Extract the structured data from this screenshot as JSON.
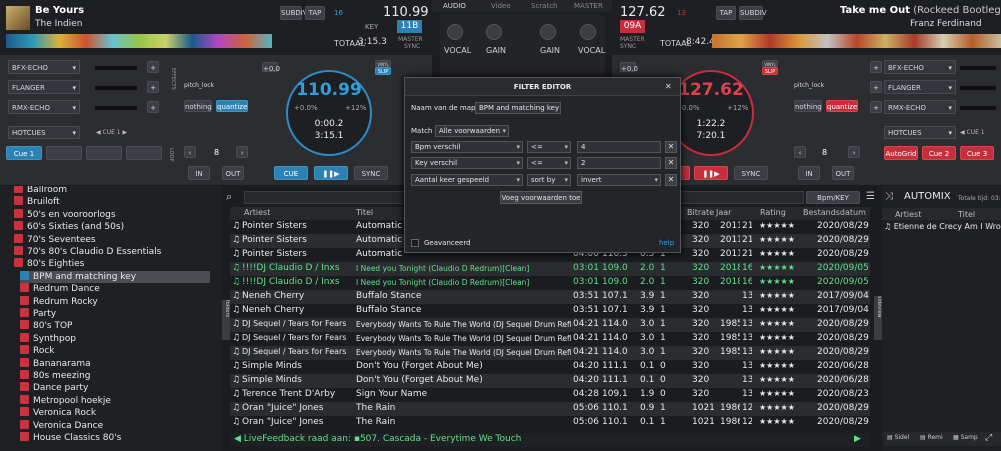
{
  "deck_left": {
    "title": "Be Yours",
    "artist": "The Indien",
    "bpm_main": "110.99",
    "bpm_small": "110.99",
    "key": "11B",
    "key_label": "KEY",
    "number": "16",
    "total_label": "TOTAAL",
    "total_time": "3:15.3",
    "master_label": "MASTER",
    "sync_label": "SYNC",
    "pitch": "+0.0",
    "bpm_ring": "110.99",
    "pct_minus": "+0.0%",
    "pct_plus": "+12%",
    "elapsed": "0:00.2",
    "remain": "3:15.1",
    "mode": "SLIP",
    "hotcues": "HOTCUES",
    "cue1": "CUE 1",
    "cue_pad": "Cue 1",
    "loop": "8",
    "in": "IN",
    "out": "OUT",
    "cue": "CUE",
    "play": "❚❚▶",
    "sync": "SYNC",
    "fx1": "BFX-ECHO",
    "fx2": "FLANGER",
    "fx3": "RMX-ECHO",
    "pitchlock": "pitch_lock",
    "nothing": "nothing",
    "quantize": "quantize_setti...",
    "vertical_fx": "EFFECTS",
    "vertical_loop": "LOOP",
    "sub_btns": [
      "SUBDIV",
      "TAP"
    ],
    "vinyl": "VINYL"
  },
  "deck_right": {
    "title": "Take me Out",
    "title_suffix": "(Rockeed Bootleg Mix)",
    "artist": "Franz Ferdinand",
    "bpm_main": "127.62",
    "key": "09A",
    "number": "13",
    "total_label": "TOTAAL",
    "total_time": "8:42.4",
    "master_label": "MASTER",
    "sync_label": "SYNC",
    "pitch": "+0.0",
    "bpm_ring": "127.62",
    "pct_minus": "+0.0%",
    "pct_plus": "+12%",
    "elapsed": "1:22.2",
    "remain": "7:20.1",
    "mode": "SLIP",
    "hotcues": "HOTCUES",
    "cue1": "CUE 1",
    "pads": [
      "AutoGrid",
      "Cue 2",
      "Cue 3"
    ],
    "loop": "8",
    "in": "IN",
    "out": "OUT",
    "cue": "CUE",
    "play": "❚❚▶",
    "sync": "SYNC",
    "fx1": "BFX-ECHO",
    "fx2": "FLANGER",
    "fx3": "RMX-ECHO",
    "pitchlock": "pitch_lock",
    "nothing": "nothing",
    "quantize": "quantize_setti...",
    "sub_btns": [
      "TAP",
      "SUBDIV"
    ],
    "vinyl": "VINYL"
  },
  "mixer": {
    "tabs": [
      "AUDIO",
      "Video",
      "Scratch",
      "MASTER"
    ],
    "vocal": "VOCAL",
    "gain": "GAIN",
    "vocal2": "VOCAL",
    "gain2": "GAIN"
  },
  "browser": {
    "tree": [
      "Ballroom",
      "Bruiloft",
      "50's en vooroorlogs",
      "60's Sixties (and 50s)",
      "70's Seventees",
      "70's 80's Claudio D Essentials",
      "80's Eighties",
      "BPM and matching key",
      "Redrum Dance",
      "Redrum Rocky",
      "Party",
      "80's TOP",
      "Synthpop",
      "Rock",
      "Bananarama",
      "80s meezing",
      "Dance party",
      "Metropool hoekje",
      "Veronica Rock",
      "Veronica Dance",
      "House Classics 80's"
    ],
    "headers": [
      "Artiest",
      "Titel",
      "Bitrate",
      "Jaar",
      "Rating",
      "Bestandsdatum"
    ],
    "bpmkey": "Bpm/KEY",
    "folders_tab": "folders",
    "sideview_tab": "sideview",
    "rows": [
      {
        "artist": "Pointer Sisters",
        "title": "Automatic",
        "len": "",
        "bpm": "",
        "key": "",
        "num": "",
        "bitrate": "320",
        "year": "2011",
        "n2": "21",
        "rating": "★★★★★",
        "date": "2020/08/29"
      },
      {
        "artist": "Pointer Sisters",
        "title": "Automatic",
        "len": "",
        "bpm": "",
        "key": "",
        "num": "",
        "bitrate": "320",
        "year": "2011",
        "n2": "21",
        "rating": "★★★★★",
        "date": "2020/08/29"
      },
      {
        "artist": "Pointer Sisters",
        "title": "Automatic",
        "len": "04:00",
        "bpm": "110.5",
        "key": "0.5",
        "num": "1",
        "bitrate": "320",
        "year": "2011",
        "n2": "21",
        "rating": "★★★★★",
        "date": "2020/08/29"
      },
      {
        "artist": "!!!!DJ Claudio D / Inxs",
        "title": "I Need you Tonight (Claudio D Redrum)[Clean]",
        "len": "03:01",
        "bpm": "109.0",
        "key": "2.0",
        "num": "1",
        "bitrate": "320",
        "year": "2018",
        "n2": "16",
        "rating": "★★★★★",
        "date": "2020/09/05"
      },
      {
        "artist": "!!!!DJ Claudio D / Inxs",
        "title": "I Need you Tonight (Claudio D Redrum)[Clean]",
        "len": "03:01",
        "bpm": "109.0",
        "key": "2.0",
        "num": "1",
        "bitrate": "320",
        "year": "2018",
        "n2": "16",
        "rating": "★★★★★",
        "date": "2020/09/05"
      },
      {
        "artist": "Neneh Cherry",
        "title": "Buffalo Stance",
        "len": "03:51",
        "bpm": "107.1",
        "key": "3.9",
        "num": "1",
        "bitrate": "320",
        "year": "",
        "n2": "13",
        "rating": "★★★★★",
        "date": "2017/09/04"
      },
      {
        "artist": "Neneh Cherry",
        "title": "Buffalo Stance",
        "len": "03:51",
        "bpm": "107.1",
        "key": "3.9",
        "num": "1",
        "bitrate": "320",
        "year": "",
        "n2": "13",
        "rating": "★★★★★",
        "date": "2017/09/04"
      },
      {
        "artist": "DJ Sequel / Tears for Fears",
        "title": "Everybody Wants To Rule The World (DJ Sequel Drum Refix)[Clean]",
        "len": "04:21",
        "bpm": "114.0",
        "key": "3.0",
        "num": "1",
        "bitrate": "320",
        "year": "1985",
        "n2": "13",
        "rating": "★★★★★",
        "date": "2020/08/29"
      },
      {
        "artist": "DJ Sequel / Tears for Fears",
        "title": "Everybody Wants To Rule The World (DJ Sequel Drum Refix)[Clean]",
        "len": "04:21",
        "bpm": "114.0",
        "key": "3.0",
        "num": "1",
        "bitrate": "320",
        "year": "1985",
        "n2": "13",
        "rating": "★★★★★",
        "date": "2020/08/29"
      },
      {
        "artist": "DJ Sequel / Tears for Fears",
        "title": "Everybody Wants To Rule The World (DJ Sequel Drum Refix)[Clean]",
        "len": "04:21",
        "bpm": "114.0",
        "key": "3.0",
        "num": "1",
        "bitrate": "320",
        "year": "1985",
        "n2": "13",
        "rating": "★★★★★",
        "date": "2020/08/29"
      },
      {
        "artist": "Simple Minds",
        "title": "Don't You (Forget About Me)",
        "len": "04:20",
        "bpm": "111.1",
        "key": "0.1",
        "num": "0",
        "bitrate": "320",
        "year": "",
        "n2": "13",
        "rating": "★★★★★",
        "date": "2020/06/28"
      },
      {
        "artist": "Simple Minds",
        "title": "Don't You (Forget About Me)",
        "len": "04:20",
        "bpm": "111.1",
        "key": "0.1",
        "num": "0",
        "bitrate": "320",
        "year": "",
        "n2": "13",
        "rating": "★★★★★",
        "date": "2020/06/28"
      },
      {
        "artist": "Terence Trent D'Arby",
        "title": "Sign Your Name",
        "len": "04:28",
        "bpm": "109.1",
        "key": "1.9",
        "num": "0",
        "bitrate": "320",
        "year": "",
        "n2": "13",
        "rating": "★★★★★",
        "date": "2020/08/23"
      },
      {
        "artist": "Oran \"Juice\" Jones",
        "title": "The Rain",
        "len": "05:06",
        "bpm": "110.1",
        "key": "0.9",
        "num": "1",
        "bitrate": "1021",
        "year": "1986",
        "n2": "12",
        "rating": "★★★★★",
        "date": "2020/08/29"
      },
      {
        "artist": "Oran \"Juice\" Jones",
        "title": "The Rain",
        "len": "05:06",
        "bpm": "110.1",
        "key": "0.1",
        "num": "1",
        "bitrate": "1021",
        "year": "1986",
        "n2": "12",
        "rating": "★★★★★",
        "date": "2020/08/29"
      }
    ],
    "livefeedback_label": "LiveFeedback raad aan:",
    "livefeedback_track": "507. Cascada - Everytime We Touch"
  },
  "automix": {
    "title": "AUTOMIX",
    "total": "Totale tijd: 03:",
    "headers": [
      "Artiest",
      "Titel"
    ],
    "row_artist": "Etienne de Crecy",
    "row_title": "Am I Wrong (ra",
    "tabs": [
      "Sidel",
      "Remi",
      "Samp"
    ]
  },
  "filter_editor": {
    "title": "FILTER EDITOR",
    "close": "✕",
    "name_label": "Naam van de map:",
    "name_value": "BPM and matching key",
    "match_label": "Match",
    "match_value": "Alle voorwaarden",
    "rules": [
      {
        "field": "Bpm verschil",
        "op": "<=",
        "value": "4"
      },
      {
        "field": "Key verschil",
        "op": "<=",
        "value": "2"
      },
      {
        "field": "Aantal keer gespeeld",
        "op": "sort by",
        "value": "invert"
      }
    ],
    "add_condition": "Voeg voorwaarden toe",
    "advanced": "Geavanceerd",
    "help": "help"
  },
  "colors": {
    "accent_blue": "#2fa0d8",
    "accent_red": "#d0303d",
    "green": "#5fe08a"
  }
}
